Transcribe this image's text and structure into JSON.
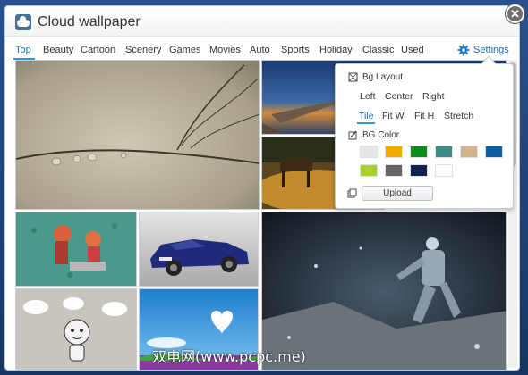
{
  "window": {
    "title": "Cloud wallpaper",
    "close_icon": "close-icon",
    "logo_icon": "cloud-logo-icon"
  },
  "tabs": [
    "Top",
    "Beauty",
    "Cartoon",
    "Scenery",
    "Games",
    "Movies",
    "Auto",
    "Sports",
    "Holiday",
    "Classic",
    "Used"
  ],
  "active_tab": "Top",
  "settings": {
    "label": "Settings",
    "icon": "gear-icon",
    "bg_layout_label": "Bg Layout",
    "layout_options": [
      "Left",
      "Center",
      "Right",
      "Tile",
      "Fit W",
      "Fit H",
      "Stretch"
    ],
    "active_layout": "Tile",
    "bg_color_label": "BG Color",
    "colors": [
      "#e6e6e6",
      "#f2a900",
      "#078c1c",
      "#3d8c8a",
      "#d4b48c",
      "#0a5fa3",
      "#a8d22c",
      "#666666",
      "#0f2250",
      "#ffffff"
    ],
    "upload_label": "Upload"
  },
  "wallpapers": [
    {
      "name": "dewdrop-stem-wallpaper"
    },
    {
      "name": "pier-sunset-wallpaper"
    },
    {
      "name": "autumn-bench-wallpaper"
    },
    {
      "name": "anime-couple-wallpaper"
    },
    {
      "name": "blue-car-wallpaper"
    },
    {
      "name": "space-astronaut-wallpaper"
    },
    {
      "name": "cartoon-character-wallpaper"
    },
    {
      "name": "heart-cloud-wallpaper"
    }
  ],
  "watermark": "双电网(www.pcpc.me)"
}
